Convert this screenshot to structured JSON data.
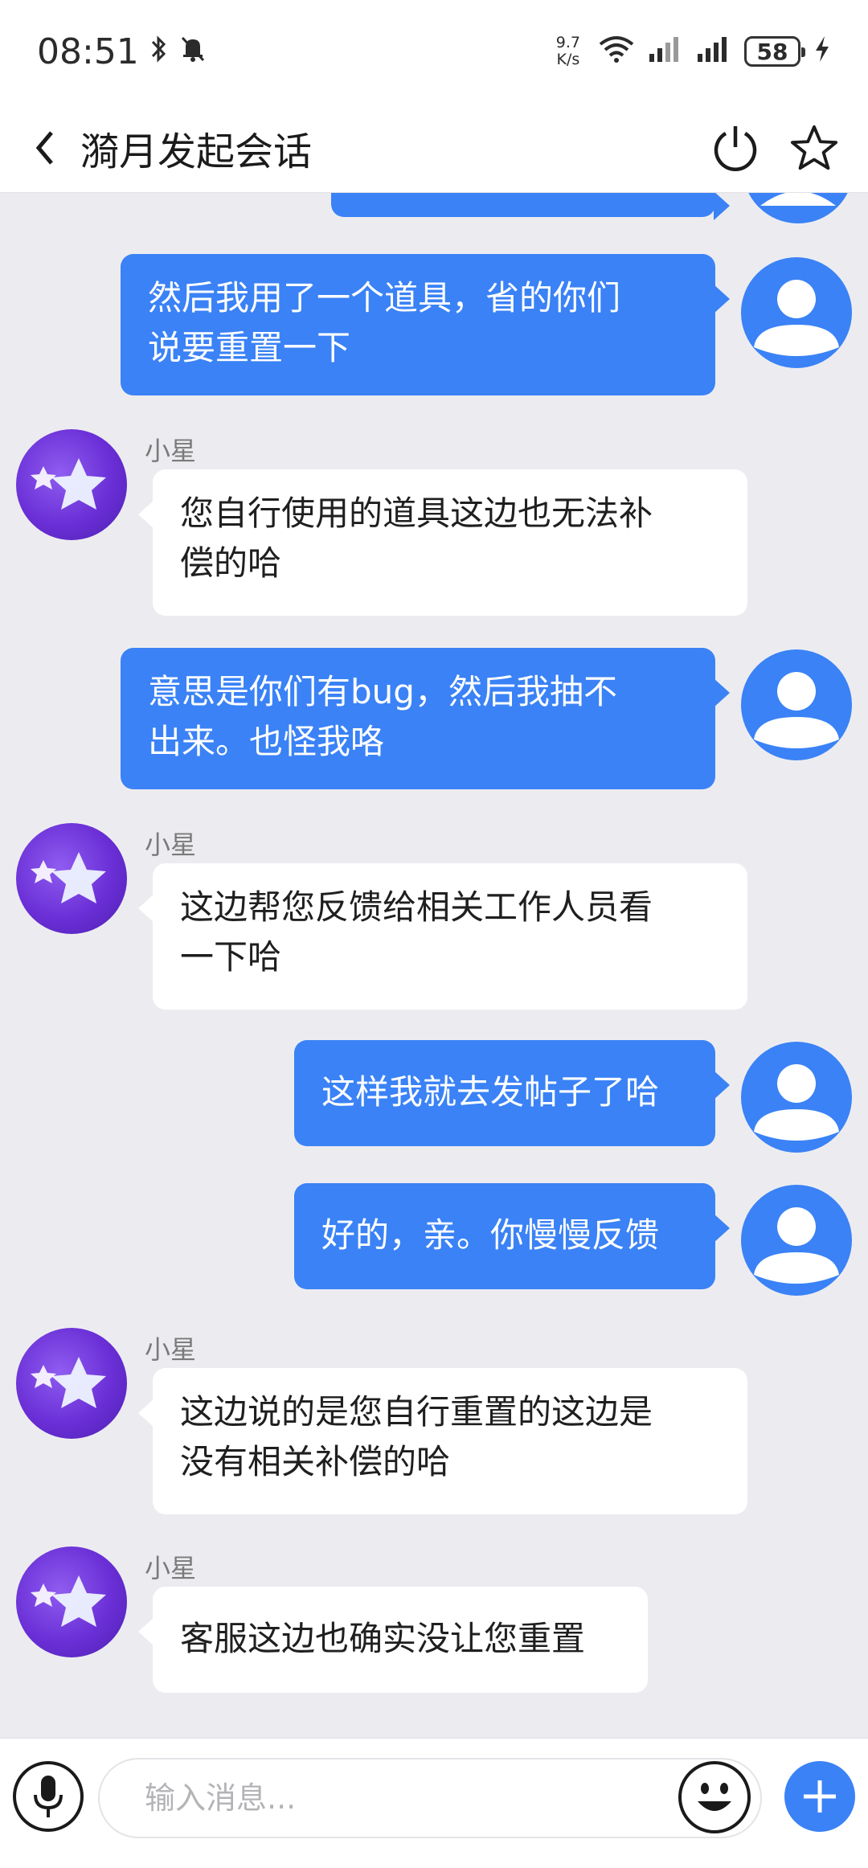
{
  "status_bar": {
    "time": "08:51",
    "net_speed_value": "9.7",
    "net_speed_unit": "K/s",
    "battery": "58",
    "icons": [
      "bluetooth-icon",
      "mute-icon",
      "wifi-icon",
      "signal-icon",
      "signal-icon",
      "charging-icon"
    ]
  },
  "header": {
    "title": "漪月发起会话",
    "actions": [
      "power-icon",
      "star-icon"
    ]
  },
  "messages": [
    {
      "direction": "out",
      "text": ""
    },
    {
      "direction": "out",
      "line1": "然后我用了一个道具，省的你们",
      "line2": "说要重置一下"
    },
    {
      "direction": "in",
      "sender": "小星",
      "line1": "您自行使用的道具这边也无法补",
      "line2": "偿的哈"
    },
    {
      "direction": "out",
      "line1": "意思是你们有bug，然后我抽不",
      "line2": "出来。也怪我咯"
    },
    {
      "direction": "in",
      "sender": "小星",
      "line1": "这边帮您反馈给相关工作人员看",
      "line2": "一下哈"
    },
    {
      "direction": "out",
      "text": "这样我就去发帖子了哈"
    },
    {
      "direction": "out",
      "text": "好的，亲。你慢慢反馈"
    },
    {
      "direction": "in",
      "sender": "小星",
      "line1": "这边说的是您自行重置的这边是",
      "line2": "没有相关补偿的哈"
    },
    {
      "direction": "in",
      "sender": "小星",
      "text": "客服这边也确实没让您重置"
    }
  ],
  "input_bar": {
    "placeholder": "输入消息...",
    "icons": [
      "microphone-icon",
      "emoji-icon",
      "plus-icon"
    ]
  },
  "colors": {
    "accent": "#3a82f6",
    "chat_background": "#ececf0",
    "bot_avatar": "#6a2fd6"
  }
}
